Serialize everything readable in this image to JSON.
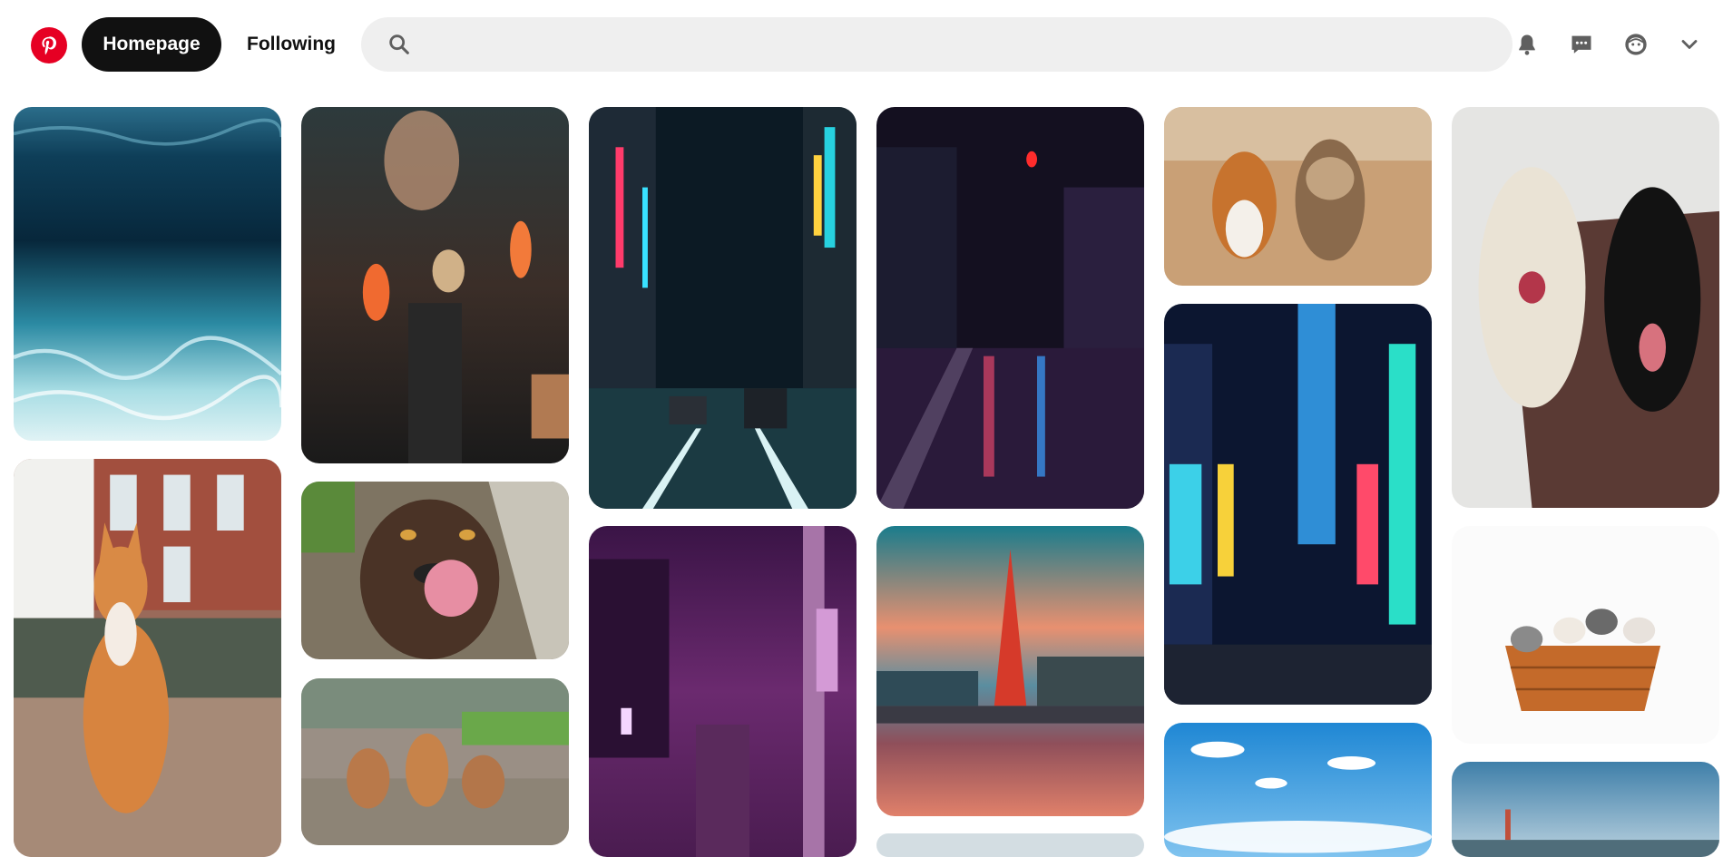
{
  "header": {
    "home_label": "Homepage",
    "following_label": "Following",
    "search": {
      "value": "",
      "placeholder": ""
    },
    "icons": {
      "logo": "pinterest-logo",
      "search": "search-icon",
      "notifications": "bell-icon",
      "messages": "chat-icon",
      "profile": "avatar-icon",
      "menu": "chevron-down-icon"
    }
  },
  "colors": {
    "brand": "#e60023",
    "active_tab_bg": "#111111",
    "search_bg": "#efefef"
  },
  "pins": [
    {
      "name": "underwater"
    },
    {
      "name": "cat-on-bricks"
    },
    {
      "name": "alley-lanterns"
    },
    {
      "name": "chocolate-lab-licking"
    },
    {
      "name": "three-puppies"
    },
    {
      "name": "neon-street-taxis"
    },
    {
      "name": "purple-neon-alley"
    },
    {
      "name": "wet-road-night"
    },
    {
      "name": "tokyo-tower-sunset"
    },
    {
      "name": "sky-bottom"
    },
    {
      "name": "corgi-and-terrier"
    },
    {
      "name": "shinjuku-neon"
    },
    {
      "name": "blue-sky-skyline"
    },
    {
      "name": "two-dogs-on-rug"
    },
    {
      "name": "kittens-in-basket"
    },
    {
      "name": "tokyo-skyline-clouds"
    }
  ]
}
